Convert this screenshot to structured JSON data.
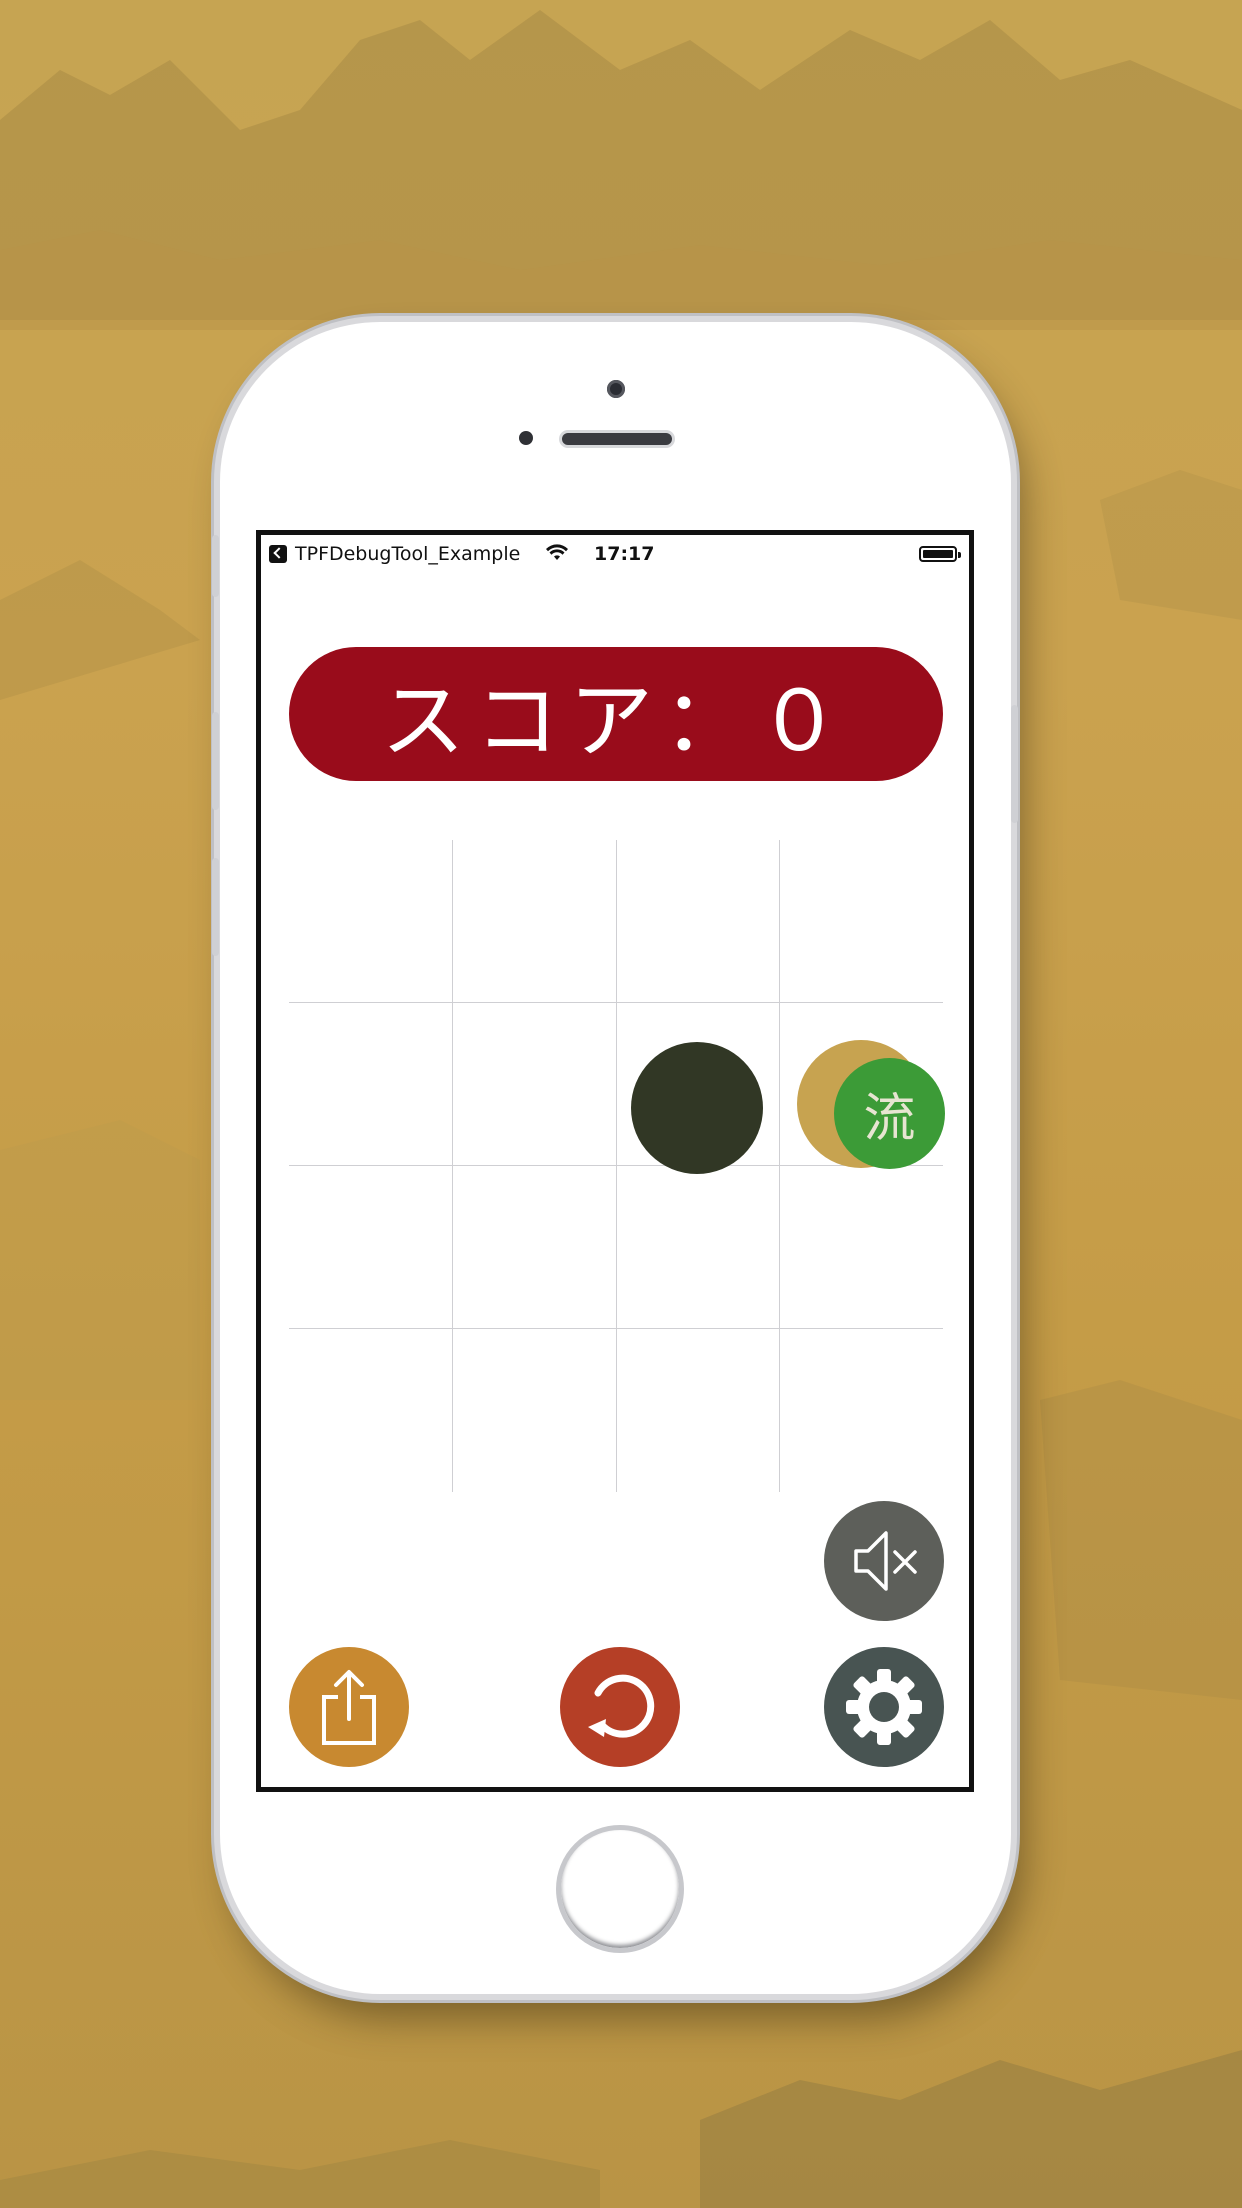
{
  "status_bar": {
    "back_app": "TPFDebugTool_Example",
    "time": "17:17",
    "icons": [
      "back-icon",
      "wifi-icon",
      "battery-icon"
    ]
  },
  "game": {
    "score_label": "スコア：０",
    "bubble_text": "流",
    "board_rows": 4,
    "board_cols": 4,
    "piece_color": "#313725"
  },
  "controls": {
    "mute_icon": "speaker-mute-icon",
    "share_icon": "share-icon",
    "restart_icon": "restart-icon",
    "settings_icon": "gear-icon"
  },
  "colors": {
    "score_bg": "#990c1b",
    "share": "#c88930",
    "restart": "#b53f26",
    "settings": "#485452",
    "mute": "#5d5f5a",
    "bubble_green": "#3c9b37",
    "bubble_gold": "#c7a350",
    "background": "#c6a452"
  }
}
